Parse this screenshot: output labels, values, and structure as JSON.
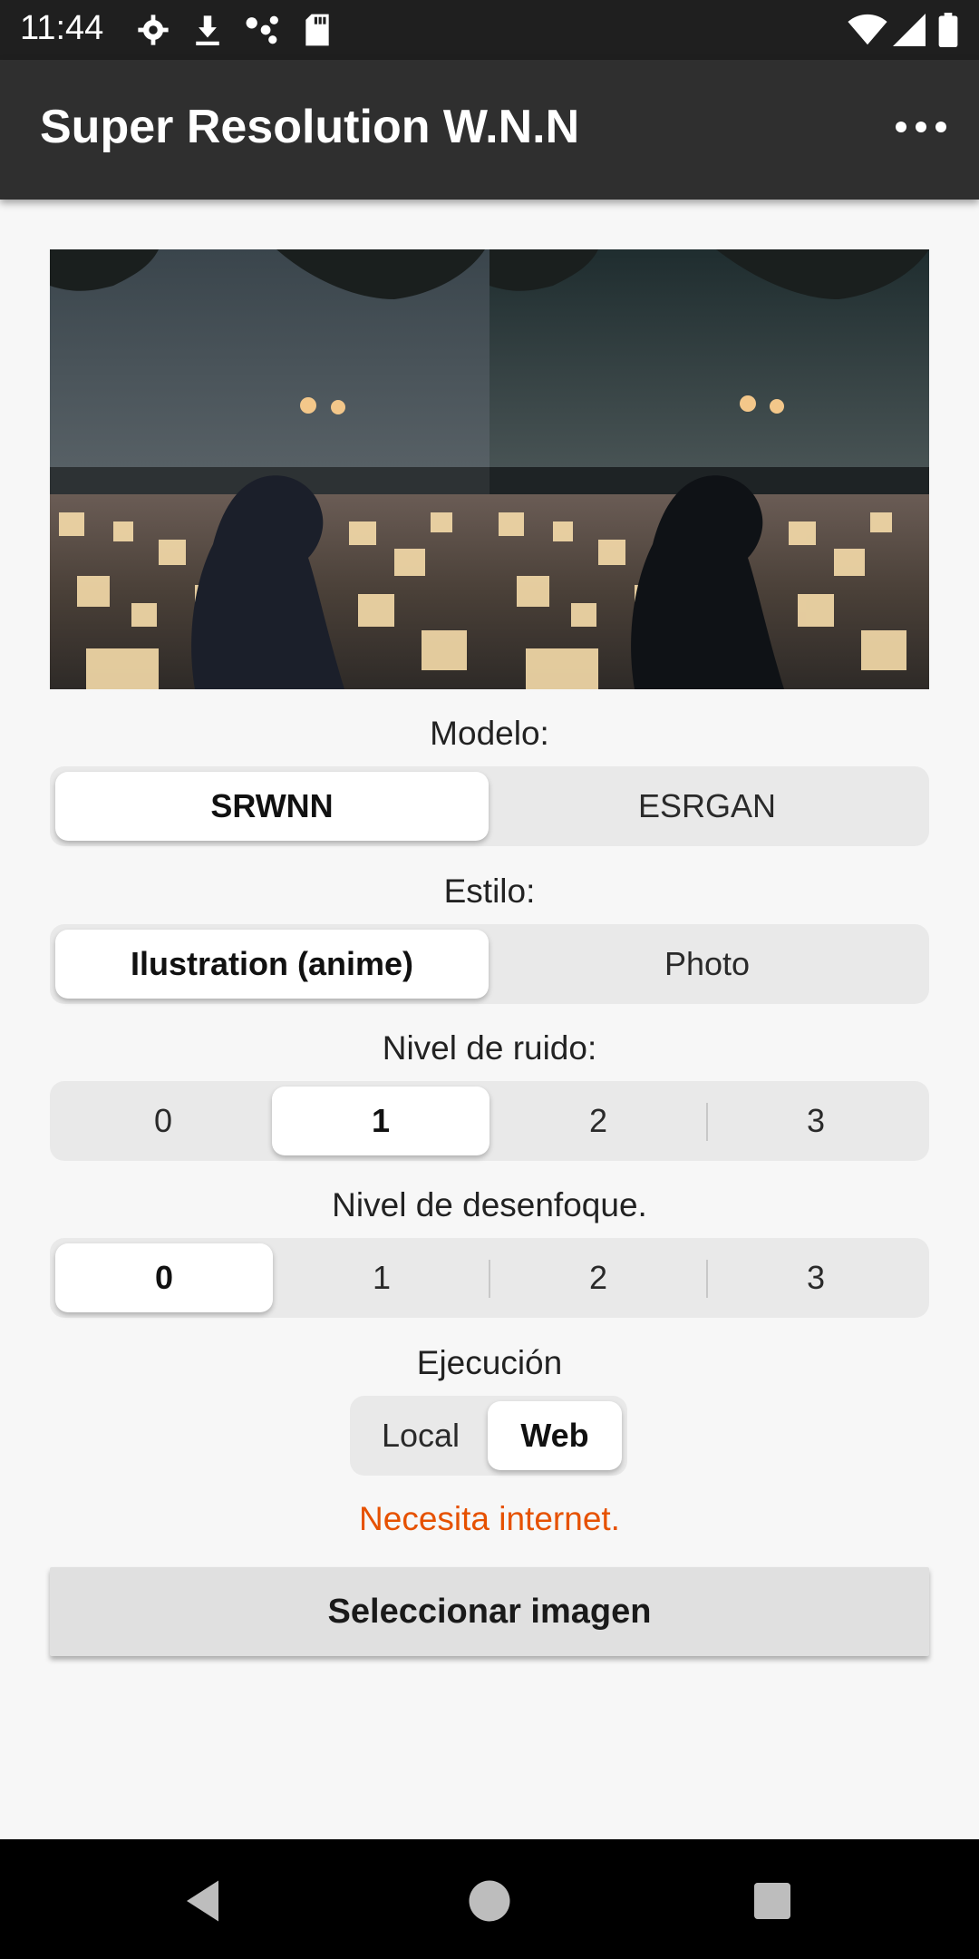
{
  "status_bar": {
    "time": "11:44",
    "icons": [
      "settings-icon",
      "download-icon",
      "dots-cluster-icon",
      "sd-card-icon",
      "wifi-icon",
      "signal-icon",
      "battery-icon"
    ]
  },
  "app_bar": {
    "title": "Super Resolution W.N.N",
    "menu_icon": "more-horizontal-icon"
  },
  "model": {
    "label": "Modelo:",
    "options": [
      "SRWNN",
      "ESRGAN"
    ],
    "selected": "SRWNN"
  },
  "style": {
    "label": "Estilo:",
    "options": [
      "Ilustration (anime)",
      "Photo"
    ],
    "selected": "Ilustration (anime)"
  },
  "noise": {
    "label": "Nivel de ruido:",
    "options": [
      "0",
      "1",
      "2",
      "3"
    ],
    "selected": "1"
  },
  "blur": {
    "label": "Nivel de desenfoque.",
    "options": [
      "0",
      "1",
      "2",
      "3"
    ],
    "selected": "0"
  },
  "execution": {
    "label": "Ejecución",
    "options": [
      "Local",
      "Web"
    ],
    "selected": "Web"
  },
  "warning": "Necesita internet.",
  "select_button": "Seleccionar imagen",
  "nav": {
    "back_icon": "back-triangle-icon",
    "home_icon": "home-circle-icon",
    "recents_icon": "recents-square-icon"
  },
  "colors": {
    "status_bar": "#1f1f1f",
    "app_bar": "#2f2f2f",
    "background": "#f7f7f7",
    "warning": "#e65100"
  }
}
